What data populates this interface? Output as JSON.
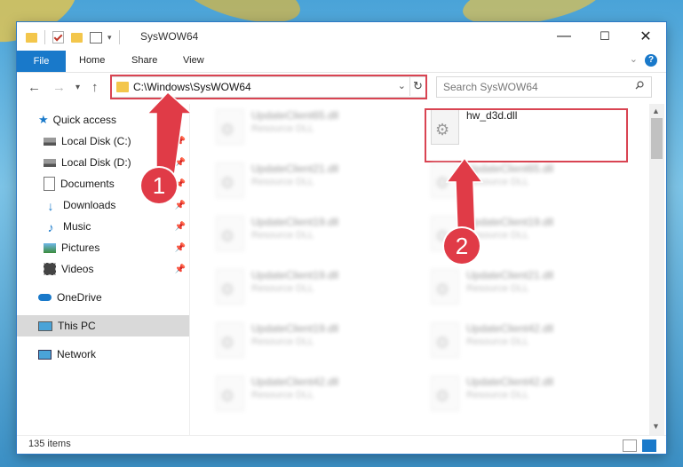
{
  "window": {
    "title": "SysWOW64",
    "controls": {
      "minimize": "—",
      "maximize": "☐",
      "close": "✕"
    }
  },
  "ribbon": {
    "file_label": "File",
    "tabs": [
      "Home",
      "Share",
      "View"
    ],
    "help": "?"
  },
  "address": {
    "path": "C:\\Windows\\SysWOW64",
    "search_placeholder": "Search SysWOW64"
  },
  "nav": {
    "quick_access": "Quick access",
    "items": [
      {
        "label": "Local Disk (C:)",
        "icon": "drive-icon",
        "pinned": true
      },
      {
        "label": "Local Disk (D:)",
        "icon": "drive-icon",
        "pinned": true
      },
      {
        "label": "Documents",
        "icon": "documents-icon",
        "pinned": true
      },
      {
        "label": "Downloads",
        "icon": "download-icon",
        "pinned": true
      },
      {
        "label": "Music",
        "icon": "music-icon",
        "pinned": true
      },
      {
        "label": "Pictures",
        "icon": "pictures-icon",
        "pinned": true
      },
      {
        "label": "Videos",
        "icon": "videos-icon",
        "pinned": true
      }
    ],
    "onedrive": "OneDrive",
    "this_pc": "This PC",
    "network": "Network"
  },
  "files": {
    "highlighted": {
      "name": "hw_d3d.dll",
      "type": ""
    },
    "left_column": [
      {
        "name": "UpdateClient65.dll",
        "type": "Resource DLL"
      },
      {
        "name": "UpdateClient21.dll",
        "type": "Resource DLL"
      },
      {
        "name": "UpdateClient19.dll",
        "type": "Resource DLL"
      },
      {
        "name": "UpdateClient19.dll",
        "type": "Resource DLL"
      },
      {
        "name": "UpdateClient19.dll",
        "type": "Resource DLL"
      },
      {
        "name": "UpdateClient42.dll",
        "type": "Resource DLL"
      }
    ],
    "right_column": [
      {
        "name": "UpdateClient65.dll",
        "type": "Resource DLL"
      },
      {
        "name": "UpdateClient19.dll",
        "type": "Resource DLL"
      },
      {
        "name": "UpdateClient21.dll",
        "type": "Resource DLL"
      },
      {
        "name": "UpdateClient42.dll",
        "type": "Resource DLL"
      },
      {
        "name": "UpdateClient42.dll",
        "type": "Resource DLL"
      }
    ]
  },
  "status": {
    "item_count": "135 items"
  },
  "annotations": {
    "marker1": "1",
    "marker2": "2",
    "color": "#e03b47"
  }
}
